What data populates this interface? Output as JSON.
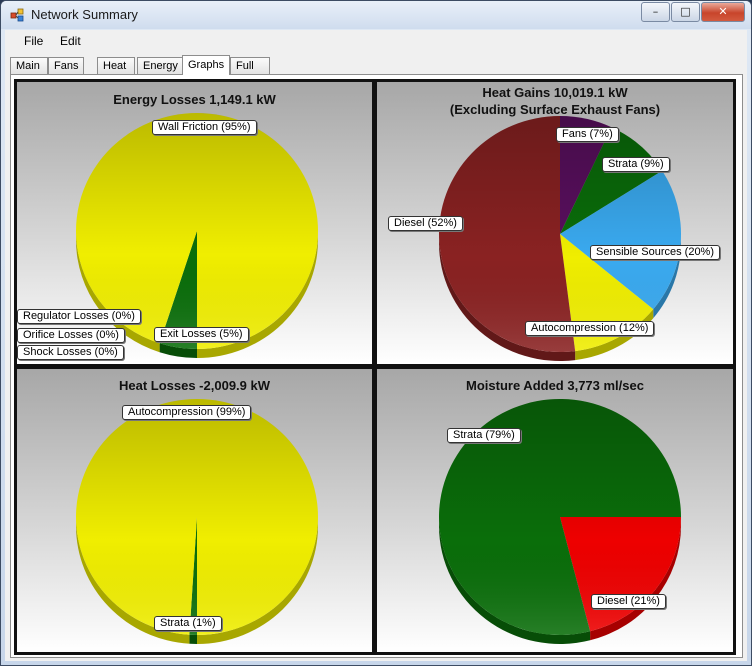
{
  "window": {
    "title": "Network Summary",
    "icon": "app-icon"
  },
  "caption_buttons": {
    "minimize": "–",
    "maximize": "□",
    "close": "✕"
  },
  "menu": [
    "File",
    "Edit"
  ],
  "tabs": [
    "Main",
    "Fans",
    "Heat",
    "Energy",
    "Graphs",
    "Full"
  ],
  "active_tab": "Graphs",
  "chart_data": [
    {
      "type": "pie",
      "title": "Energy Losses 1,149.1 kW",
      "slices": [
        {
          "label": "Wall Friction (95%)",
          "value": 95,
          "color": "#f0ee00"
        },
        {
          "label": "Exit Losses (5%)",
          "value": 5,
          "color": "#0a6e0a"
        },
        {
          "label": "Shock Losses (0%)",
          "value": 0,
          "color": "#0a6e0a"
        },
        {
          "label": "Orifice Losses (0%)",
          "value": 0,
          "color": "#0a6e0a"
        },
        {
          "label": "Regulator Losses (0%)",
          "value": 0,
          "color": "#0a6e0a"
        }
      ]
    },
    {
      "type": "pie",
      "title": "Heat Gains  10,019.1 kW",
      "subtitle": "(Excluding Surface Exhaust Fans)",
      "slices": [
        {
          "label": "Fans (7%)",
          "value": 7,
          "color": "#5a0f5f"
        },
        {
          "label": "Strata (9%)",
          "value": 9,
          "color": "#0a6e0a"
        },
        {
          "label": "Sensible Sources (20%)",
          "value": 20,
          "color": "#3aaaf0"
        },
        {
          "label": "Autocompression (12%)",
          "value": 12,
          "color": "#f0ee00"
        },
        {
          "label": "Diesel (52%)",
          "value": 52,
          "color": "#8a2222"
        }
      ]
    },
    {
      "type": "pie",
      "title": "Heat Losses -2,009.9 kW",
      "slices": [
        {
          "label": "Autocompression (99%)",
          "value": 99,
          "color": "#f0ee00"
        },
        {
          "label": "Strata (1%)",
          "value": 1,
          "color": "#0a6e0a"
        }
      ]
    },
    {
      "type": "pie",
      "title": "Moisture Added 3,773 ml/sec",
      "slices": [
        {
          "label": "Diesel (21%)",
          "value": 21,
          "color": "#ee0000"
        },
        {
          "label": "Strata (79%)",
          "value": 79,
          "color": "#0a6e0a"
        }
      ]
    }
  ]
}
